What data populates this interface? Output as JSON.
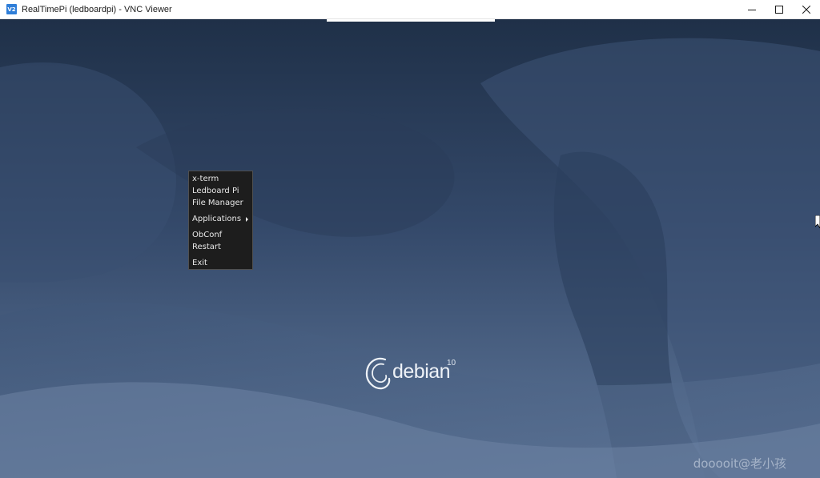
{
  "window": {
    "title": "RealTimePi (ledboardpi) - VNC Viewer",
    "app_icon_label": "V2",
    "controls": {
      "minimize_icon": "minimize-icon",
      "maximize_icon": "maximize-icon",
      "close_icon": "close-icon"
    }
  },
  "desktop": {
    "wallpaper": "debian-10-buster-wallpaper",
    "colors": {
      "dark": "#1f3048",
      "mid": "#3d5577",
      "light": "#6f86a6"
    }
  },
  "menu": {
    "items": [
      {
        "label": "x-term"
      },
      {
        "label": "Ledboard Pi"
      },
      {
        "label": "File Manager"
      },
      {
        "label": "Applications",
        "submenu": true
      },
      {
        "label": "ObConf"
      },
      {
        "label": "Restart"
      },
      {
        "label": "Exit"
      }
    ]
  },
  "logo": {
    "word": "debian",
    "version": "10"
  },
  "watermark": "dooooit@老小孩"
}
